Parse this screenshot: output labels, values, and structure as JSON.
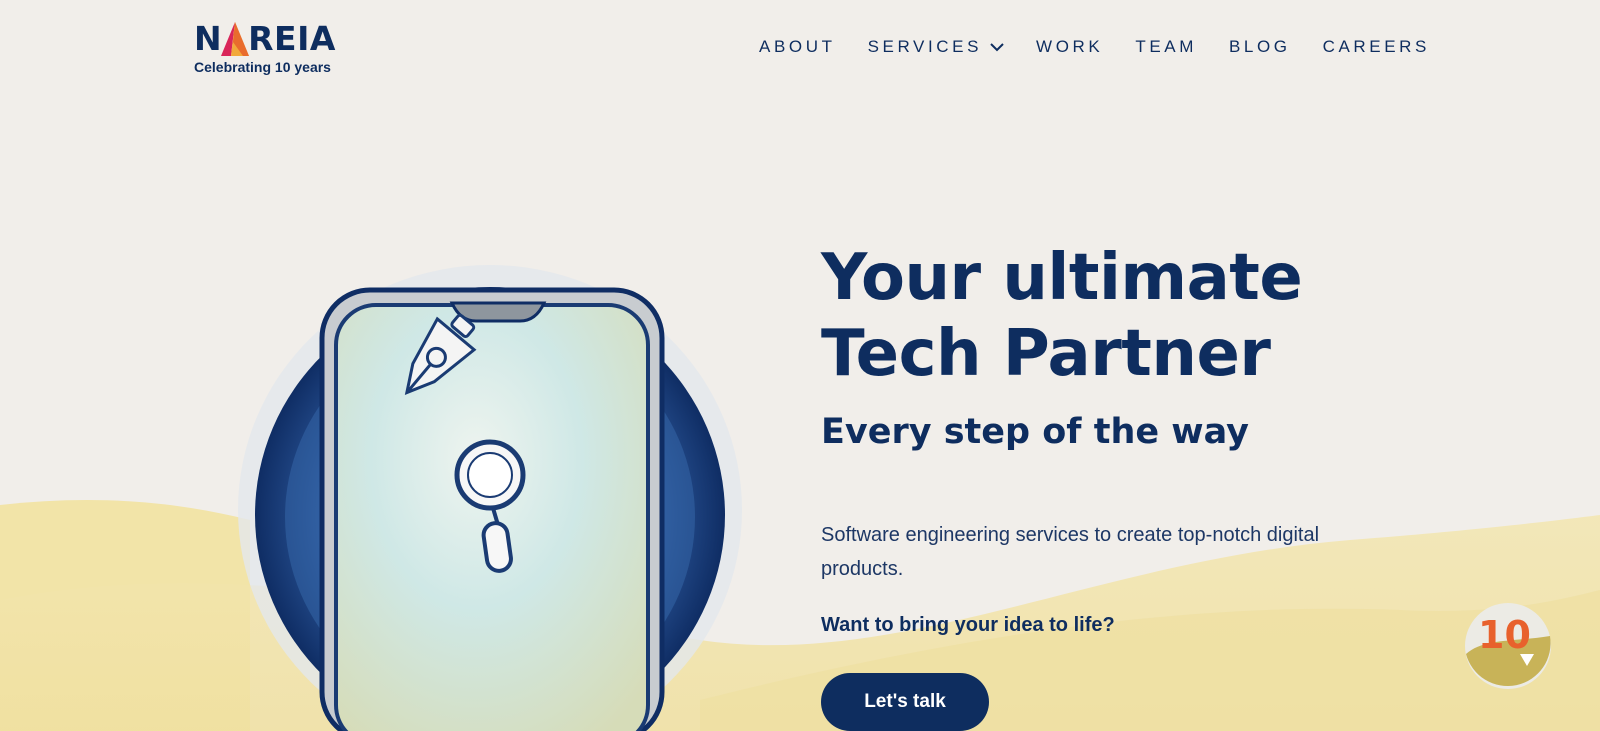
{
  "brand": {
    "name_before_a": "N",
    "name_after_a": "REIA",
    "tagline": "Celebrating 10 years",
    "logo_accent_colors": [
      "#f2a93b",
      "#e8612c",
      "#d9265a"
    ]
  },
  "nav": {
    "items": [
      {
        "label": "ABOUT"
      },
      {
        "label": "SERVICES",
        "has_dropdown": true
      },
      {
        "label": "WORK"
      },
      {
        "label": "TEAM"
      },
      {
        "label": "BLOG"
      },
      {
        "label": "CAREERS"
      }
    ]
  },
  "hero": {
    "title_line1": "Your ultimate",
    "title_line2": "Tech Partner",
    "subtitle": "Every step of the way",
    "description": "Software engineering services to create top-notch digital products.",
    "cta_question": "Want to bring your idea to life?",
    "cta_label": "Let's talk",
    "illustration_icons": [
      "pen-nib-icon",
      "magnifier-icon"
    ]
  },
  "badge": {
    "label": "10",
    "icon": "play-triangle-icon"
  },
  "colors": {
    "brand_navy": "#0e2d5f",
    "background": "#f1eeea",
    "sand": "#f0e3a8"
  }
}
